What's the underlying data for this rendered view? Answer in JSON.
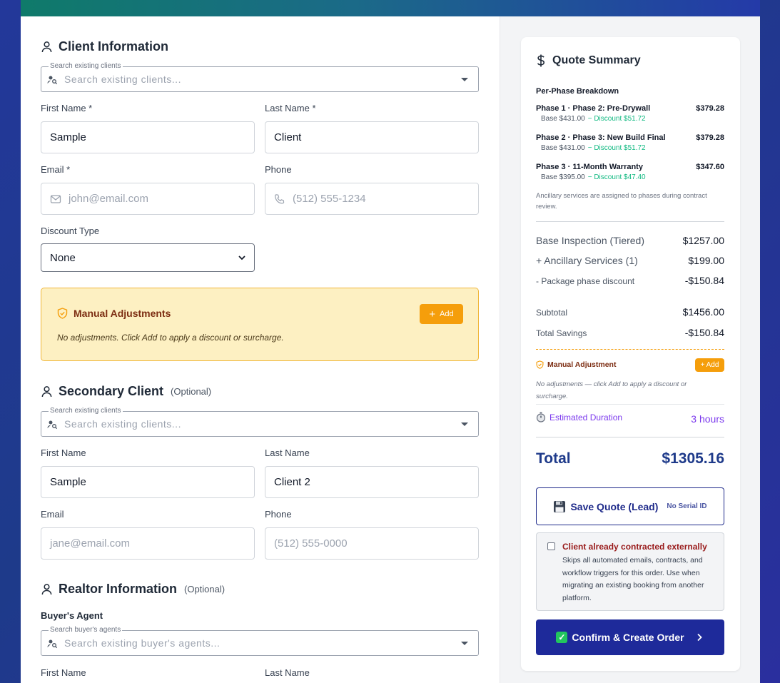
{
  "client": {
    "title": "Client Information",
    "search_legend": "Search existing clients",
    "search_placeholder": "Search existing clients...",
    "first_name_label": "First Name *",
    "first_name_value": "Sample",
    "last_name_label": "Last Name *",
    "last_name_value": "Client",
    "email_label": "Email *",
    "email_placeholder": "john@email.com",
    "phone_label": "Phone",
    "phone_placeholder": "(512) 555-1234",
    "discount_label": "Discount Type",
    "discount_value": "None"
  },
  "manual_adjustments": {
    "title": "Manual Adjustments",
    "add_label": "Add",
    "description": "No adjustments. Click Add to apply a discount or surcharge."
  },
  "secondary": {
    "title": "Secondary Client",
    "optional": "(Optional)",
    "search_legend": "Search existing clients",
    "search_placeholder": "Search existing clients...",
    "first_name_label": "First Name",
    "first_name_value": "Sample",
    "last_name_label": "Last Name",
    "last_name_value": "Client 2",
    "email_label": "Email",
    "email_placeholder": "jane@email.com",
    "phone_label": "Phone",
    "phone_placeholder": "(512) 555-0000"
  },
  "realtor": {
    "title": "Realtor Information",
    "optional": "(Optional)",
    "buyers_agent_label": "Buyer's Agent",
    "search_legend": "Search buyer's agents",
    "search_placeholder": "Search existing buyer's agents...",
    "first_name_label": "First Name",
    "last_name_label": "Last Name"
  },
  "summary": {
    "title": "Quote Summary",
    "phase_header": "Per-Phase Breakdown",
    "phases": [
      {
        "name": "Phase 1 · Phase 2: Pre-Drywall",
        "price": "$379.28",
        "base": "Base $431.00",
        "discount": "− Discount $51.72"
      },
      {
        "name": "Phase 2 · Phase 3: New Build Final",
        "price": "$379.28",
        "base": "Base $431.00",
        "discount": "− Discount $51.72"
      },
      {
        "name": "Phase 3 · 11-Month Warranty",
        "price": "$347.60",
        "base": "Base $395.00",
        "discount": "− Discount $47.40"
      }
    ],
    "ancillary_note": "Ancillary services are assigned to phases during contract review.",
    "base_inspection_label": "Base Inspection (Tiered)",
    "base_inspection_value": "$1257.00",
    "ancillary_label": "+ Ancillary Services (1)",
    "ancillary_value": "$199.00",
    "package_discount_label": "- Package phase discount",
    "package_discount_value": "-$150.84",
    "subtotal_label": "Subtotal",
    "subtotal_value": "$1456.00",
    "savings_label": "Total Savings",
    "savings_value": "-$150.84",
    "manual_adj_label": "Manual Adjustment",
    "manual_adj_add": "+ Add",
    "manual_adj_desc": "No adjustments — click Add to apply a discount or surcharge.",
    "duration_label": "Estimated Duration",
    "duration_value": "3 hours",
    "total_label": "Total",
    "total_value": "$1305.16",
    "save_label": "Save Quote (Lead)",
    "save_sub": "No Serial ID",
    "external_title": "Client already contracted externally",
    "external_desc": "Skips all automated emails, contracts, and workflow triggers for this order. Use when migrating an existing booking from another platform.",
    "confirm_label": "Confirm & Create Order"
  },
  "colors": {
    "accent": "#1e2a9a",
    "green": "#10b981",
    "orange": "#f59e0b",
    "purple": "#7c3aed"
  },
  "icons": [
    "person-icon",
    "search-person-icon",
    "mail-icon",
    "phone-icon",
    "shield-icon",
    "dollar-icon",
    "stopwatch-icon",
    "floppy-icon",
    "check-icon",
    "chevron-right-icon",
    "chevron-down-icon",
    "plus-icon"
  ]
}
